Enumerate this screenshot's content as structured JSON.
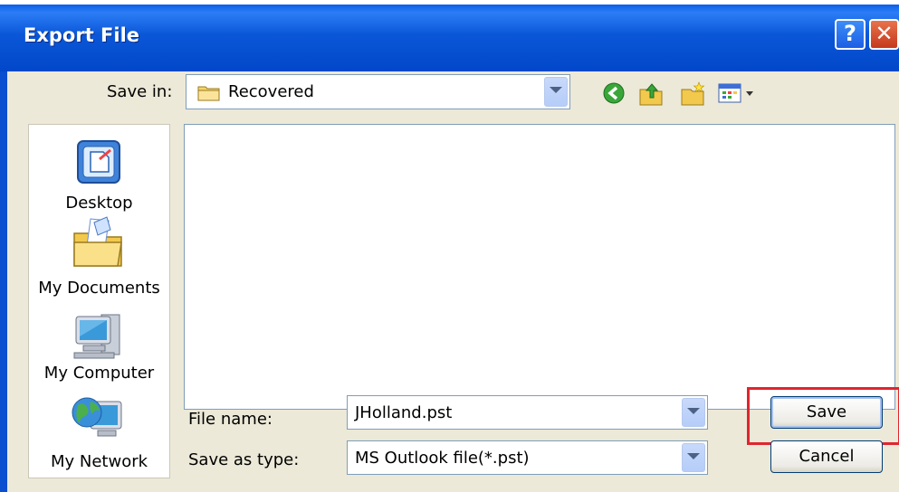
{
  "window": {
    "title": "Export File",
    "help_label": "?",
    "close_label": "✕"
  },
  "save_in": {
    "label": "Save in:",
    "value": "Recovered",
    "icon": "folder-icon"
  },
  "toolbar": {
    "icons": [
      "back-icon",
      "up-folder-icon",
      "new-folder-icon",
      "views-menu-icon"
    ]
  },
  "places_bar": {
    "items": [
      {
        "label": "Desktop",
        "icon": "desktop-icon"
      },
      {
        "label": "My Documents",
        "icon": "my-documents-icon"
      },
      {
        "label": "My Computer",
        "icon": "my-computer-icon"
      },
      {
        "label": "My Network",
        "icon": "my-network-icon"
      }
    ]
  },
  "file_list": {
    "items": []
  },
  "file_name": {
    "label": "File name:",
    "value": "JHolland.pst"
  },
  "save_as_type": {
    "label": "Save as type:",
    "value": "MS Outlook file(*.pst)"
  },
  "buttons": {
    "save": "Save",
    "cancel": "Cancel"
  },
  "colors": {
    "title_bar": "#0a57d8",
    "dialog_bg": "#ece9d8",
    "highlight": "#e0252e"
  }
}
